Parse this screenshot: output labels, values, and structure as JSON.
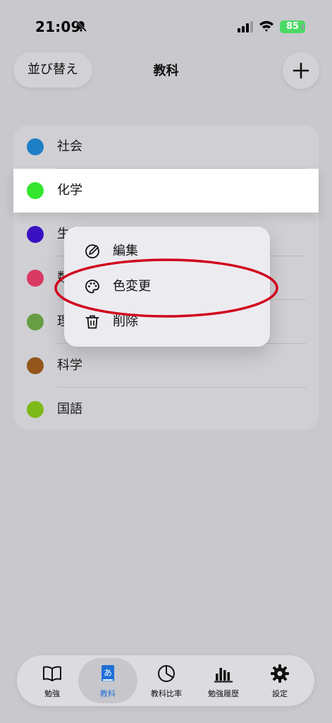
{
  "status_bar": {
    "time": "21:09",
    "battery": "85"
  },
  "header": {
    "sort_label": "並び替え",
    "title": "教科",
    "add_icon": "plus-icon"
  },
  "subjects": [
    {
      "name": "社会",
      "color": "#1e7fc6"
    },
    {
      "name": "化学",
      "color": "#34e62f"
    },
    {
      "name": "生物",
      "color": "#3a12c2"
    },
    {
      "name": "数学",
      "color": "#d83a64"
    },
    {
      "name": "理科",
      "color": "#689d45"
    },
    {
      "name": "科学",
      "color": "#94561b"
    },
    {
      "name": "国語",
      "color": "#7eb91a"
    }
  ],
  "context_menu": {
    "items": [
      {
        "label": "編集",
        "icon": "edit-icon"
      },
      {
        "label": "色変更",
        "icon": "palette-icon"
      },
      {
        "label": "削除",
        "icon": "trash-icon"
      }
    ]
  },
  "annotation": {
    "color": "#d0001c"
  },
  "tab_bar": {
    "tabs": [
      {
        "label": "勉強",
        "icon": "book-icon"
      },
      {
        "label": "教科",
        "icon": "subject-book-icon",
        "active": true
      },
      {
        "label": "教科比率",
        "icon": "pie-chart-icon"
      },
      {
        "label": "勉強履歴",
        "icon": "bar-chart-icon"
      },
      {
        "label": "設定",
        "icon": "gear-icon"
      }
    ]
  }
}
